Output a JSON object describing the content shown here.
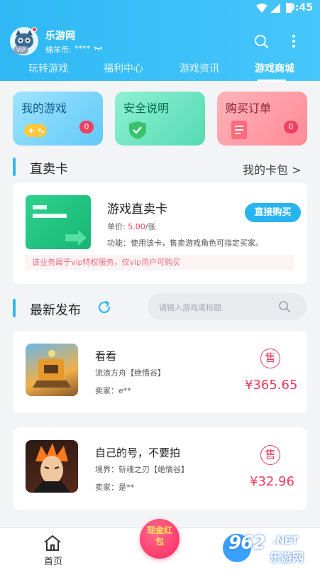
{
  "status": {
    "time": "9:45"
  },
  "header": {
    "app_name": "乐游网",
    "vip_badge": "VIP",
    "coin_label": "绵羊币:",
    "coin_value": "****",
    "tabs": [
      {
        "label": "玩转游戏"
      },
      {
        "label": "福利中心"
      },
      {
        "label": "游戏资讯"
      },
      {
        "label": "游戏商城"
      }
    ]
  },
  "quick_cards": [
    {
      "title": "我的游戏",
      "badge": "0",
      "icon": "gamepad-icon",
      "color": "#7cd6fb"
    },
    {
      "title": "安全说明",
      "badge": "",
      "icon": "shield-icon",
      "color": "#6fe3c2"
    },
    {
      "title": "购买订单",
      "badge": "0",
      "icon": "order-icon",
      "color": "#ff9aa4"
    }
  ],
  "direct_card": {
    "section_title": "直卖卡",
    "link": "我的卡包 >",
    "product_title": "游戏直卖卡",
    "price_label": "单价:",
    "price_value": "5.00",
    "price_unit": "/张",
    "function_text": "功能：使用该卡，售卖游戏角色可指定买家。",
    "buy_label": "直接购买",
    "notice": "该业务属于vip特权服务，仅vip用户可购买"
  },
  "latest": {
    "section_title": "最新发布",
    "search_placeholder": "请输入游戏或标题"
  },
  "listings": [
    {
      "title": "看看",
      "game": "流浪方舟【绝情谷】",
      "seller": "卖家：e**",
      "badge": "售",
      "price": "¥365.65"
    },
    {
      "title": "自己的号，不要拍",
      "game": "境界：斩魂之刃【绝情谷】",
      "seller": "卖家：是**",
      "badge": "售",
      "price": "¥32.96"
    }
  ],
  "bottom_nav": {
    "home_label": "首页",
    "redpacket_label": "现金红包"
  },
  "watermark": {
    "number": "962",
    "net": ".NET",
    "site": "乐游网"
  },
  "colors": {
    "accent": "#2fb8f5",
    "price": "#ef3b5e",
    "badge": "#f33f62"
  }
}
